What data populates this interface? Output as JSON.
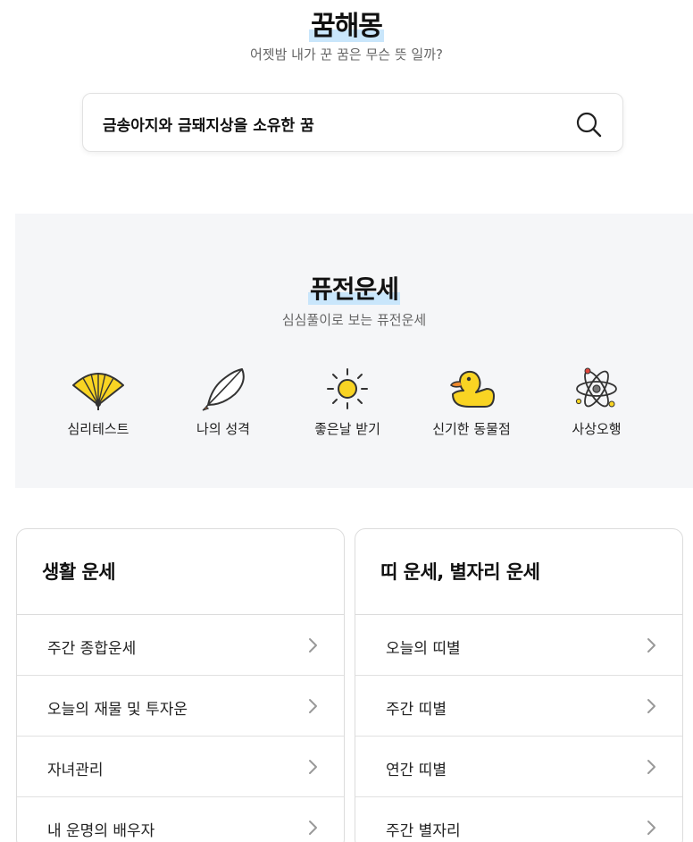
{
  "header": {
    "title": "꿈해몽",
    "subtitle": "어젯밤 내가 꾼 꿈은 무슨 뜻 일까?"
  },
  "search": {
    "value": "금송아지와 금돼지상을 소유한 꿈",
    "icon": "search-icon"
  },
  "fusion": {
    "title": "퓨전운세",
    "subtitle": "심심풀이로 보는 퓨전운세",
    "categories": [
      {
        "label": "심리테스트",
        "icon": "fan-icon"
      },
      {
        "label": "나의 성격",
        "icon": "feather-icon"
      },
      {
        "label": "좋은날 받기",
        "icon": "sun-icon"
      },
      {
        "label": "신기한 동물점",
        "icon": "duck-icon"
      },
      {
        "label": "사상오행",
        "icon": "atom-icon"
      }
    ]
  },
  "cards": [
    {
      "title": "생활 운세",
      "items": [
        "주간 종합운세",
        "오늘의 재물 및 투자운",
        "자녀관리",
        "내 운명의 배우자"
      ]
    },
    {
      "title": "띠 운세, 별자리 운세",
      "items": [
        "오늘의 띠별",
        "주간 띠별",
        "연간 띠별",
        "주간 별자리"
      ]
    }
  ],
  "colors": {
    "highlight": "#c9e6fb",
    "section_bg": "#f5f6f8",
    "yellow": "#f9d423",
    "border": "#dcdcdc"
  }
}
